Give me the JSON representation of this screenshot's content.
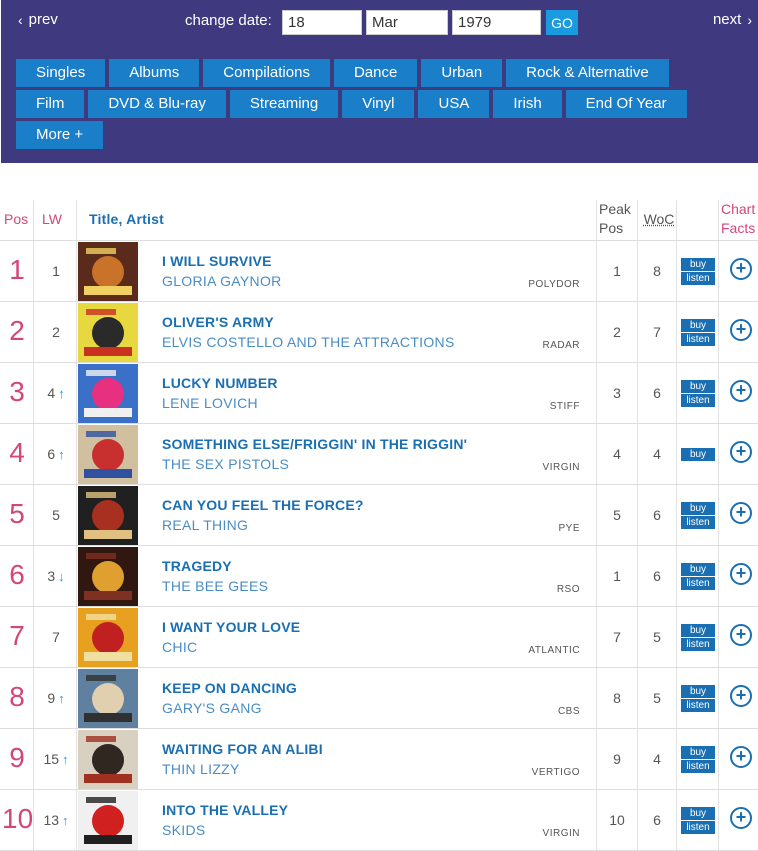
{
  "nav": {
    "prev_label": "prev",
    "next_label": "next",
    "change_date_label": "change date:",
    "go_label": "GO"
  },
  "date": {
    "day": "18",
    "month": "Mar",
    "year": "1979"
  },
  "categories_row1": [
    "Singles",
    "Albums",
    "Compilations",
    "Dance",
    "Urban",
    "Rock & Alternative"
  ],
  "categories_row2": [
    "Film",
    "DVD & Blu-ray",
    "Streaming",
    "Vinyl",
    "USA",
    "Irish",
    "End Of Year"
  ],
  "categories_row3": [
    "More +"
  ],
  "table_headers": {
    "pos": "Pos",
    "lw": "LW",
    "title": "Title, Artist",
    "peak_line1": "Peak",
    "peak_line2": "Pos",
    "woc": "WoC",
    "facts_line1": "Chart",
    "facts_line2": "Facts"
  },
  "buttons": {
    "buy": "buy",
    "listen": "listen",
    "plus": "+"
  },
  "colors": {
    "header_bg": "#3f3a80",
    "category_btn": "#1a7ec8",
    "accent_pink": "#d4467a",
    "link_blue": "#1a6fb3",
    "go_btn": "#1a9be0"
  },
  "rows": [
    {
      "pos": "1",
      "lw": "1",
      "move": "none",
      "title": "I WILL SURVIVE",
      "artist": "GLORIA GAYNOR",
      "label": "POLYDOR",
      "peak": "1",
      "woc": "8",
      "listen": true
    },
    {
      "pos": "2",
      "lw": "2",
      "move": "none",
      "title": "OLIVER'S ARMY",
      "artist": "ELVIS COSTELLO AND THE ATTRACTIONS",
      "label": "RADAR",
      "peak": "2",
      "woc": "7",
      "listen": true
    },
    {
      "pos": "3",
      "lw": "4",
      "move": "up",
      "title": "LUCKY NUMBER",
      "artist": "LENE LOVICH",
      "label": "STIFF",
      "peak": "3",
      "woc": "6",
      "listen": true
    },
    {
      "pos": "4",
      "lw": "6",
      "move": "up",
      "title": "SOMETHING ELSE/FRIGGIN' IN THE RIGGIN'",
      "artist": "THE SEX PISTOLS",
      "label": "VIRGIN",
      "peak": "4",
      "woc": "4",
      "listen": false
    },
    {
      "pos": "5",
      "lw": "5",
      "move": "none",
      "title": "CAN YOU FEEL THE FORCE?",
      "artist": "REAL THING",
      "label": "PYE",
      "peak": "5",
      "woc": "6",
      "listen": true
    },
    {
      "pos": "6",
      "lw": "3",
      "move": "down",
      "title": "TRAGEDY",
      "artist": "THE BEE GEES",
      "label": "RSO",
      "peak": "1",
      "woc": "6",
      "listen": true
    },
    {
      "pos": "7",
      "lw": "7",
      "move": "none",
      "title": "I WANT YOUR LOVE",
      "artist": "CHIC",
      "label": "ATLANTIC",
      "peak": "7",
      "woc": "5",
      "listen": true
    },
    {
      "pos": "8",
      "lw": "9",
      "move": "up",
      "title": "KEEP ON DANCING",
      "artist": "GARY'S GANG",
      "label": "CBS",
      "peak": "8",
      "woc": "5",
      "listen": true
    },
    {
      "pos": "9",
      "lw": "15",
      "move": "up",
      "title": "WAITING FOR AN ALIBI",
      "artist": "THIN LIZZY",
      "label": "VERTIGO",
      "peak": "9",
      "woc": "4",
      "listen": true
    },
    {
      "pos": "10",
      "lw": "13",
      "move": "up",
      "title": "INTO THE VALLEY",
      "artist": "SKIDS",
      "label": "VIRGIN",
      "peak": "10",
      "woc": "6",
      "listen": true
    }
  ]
}
